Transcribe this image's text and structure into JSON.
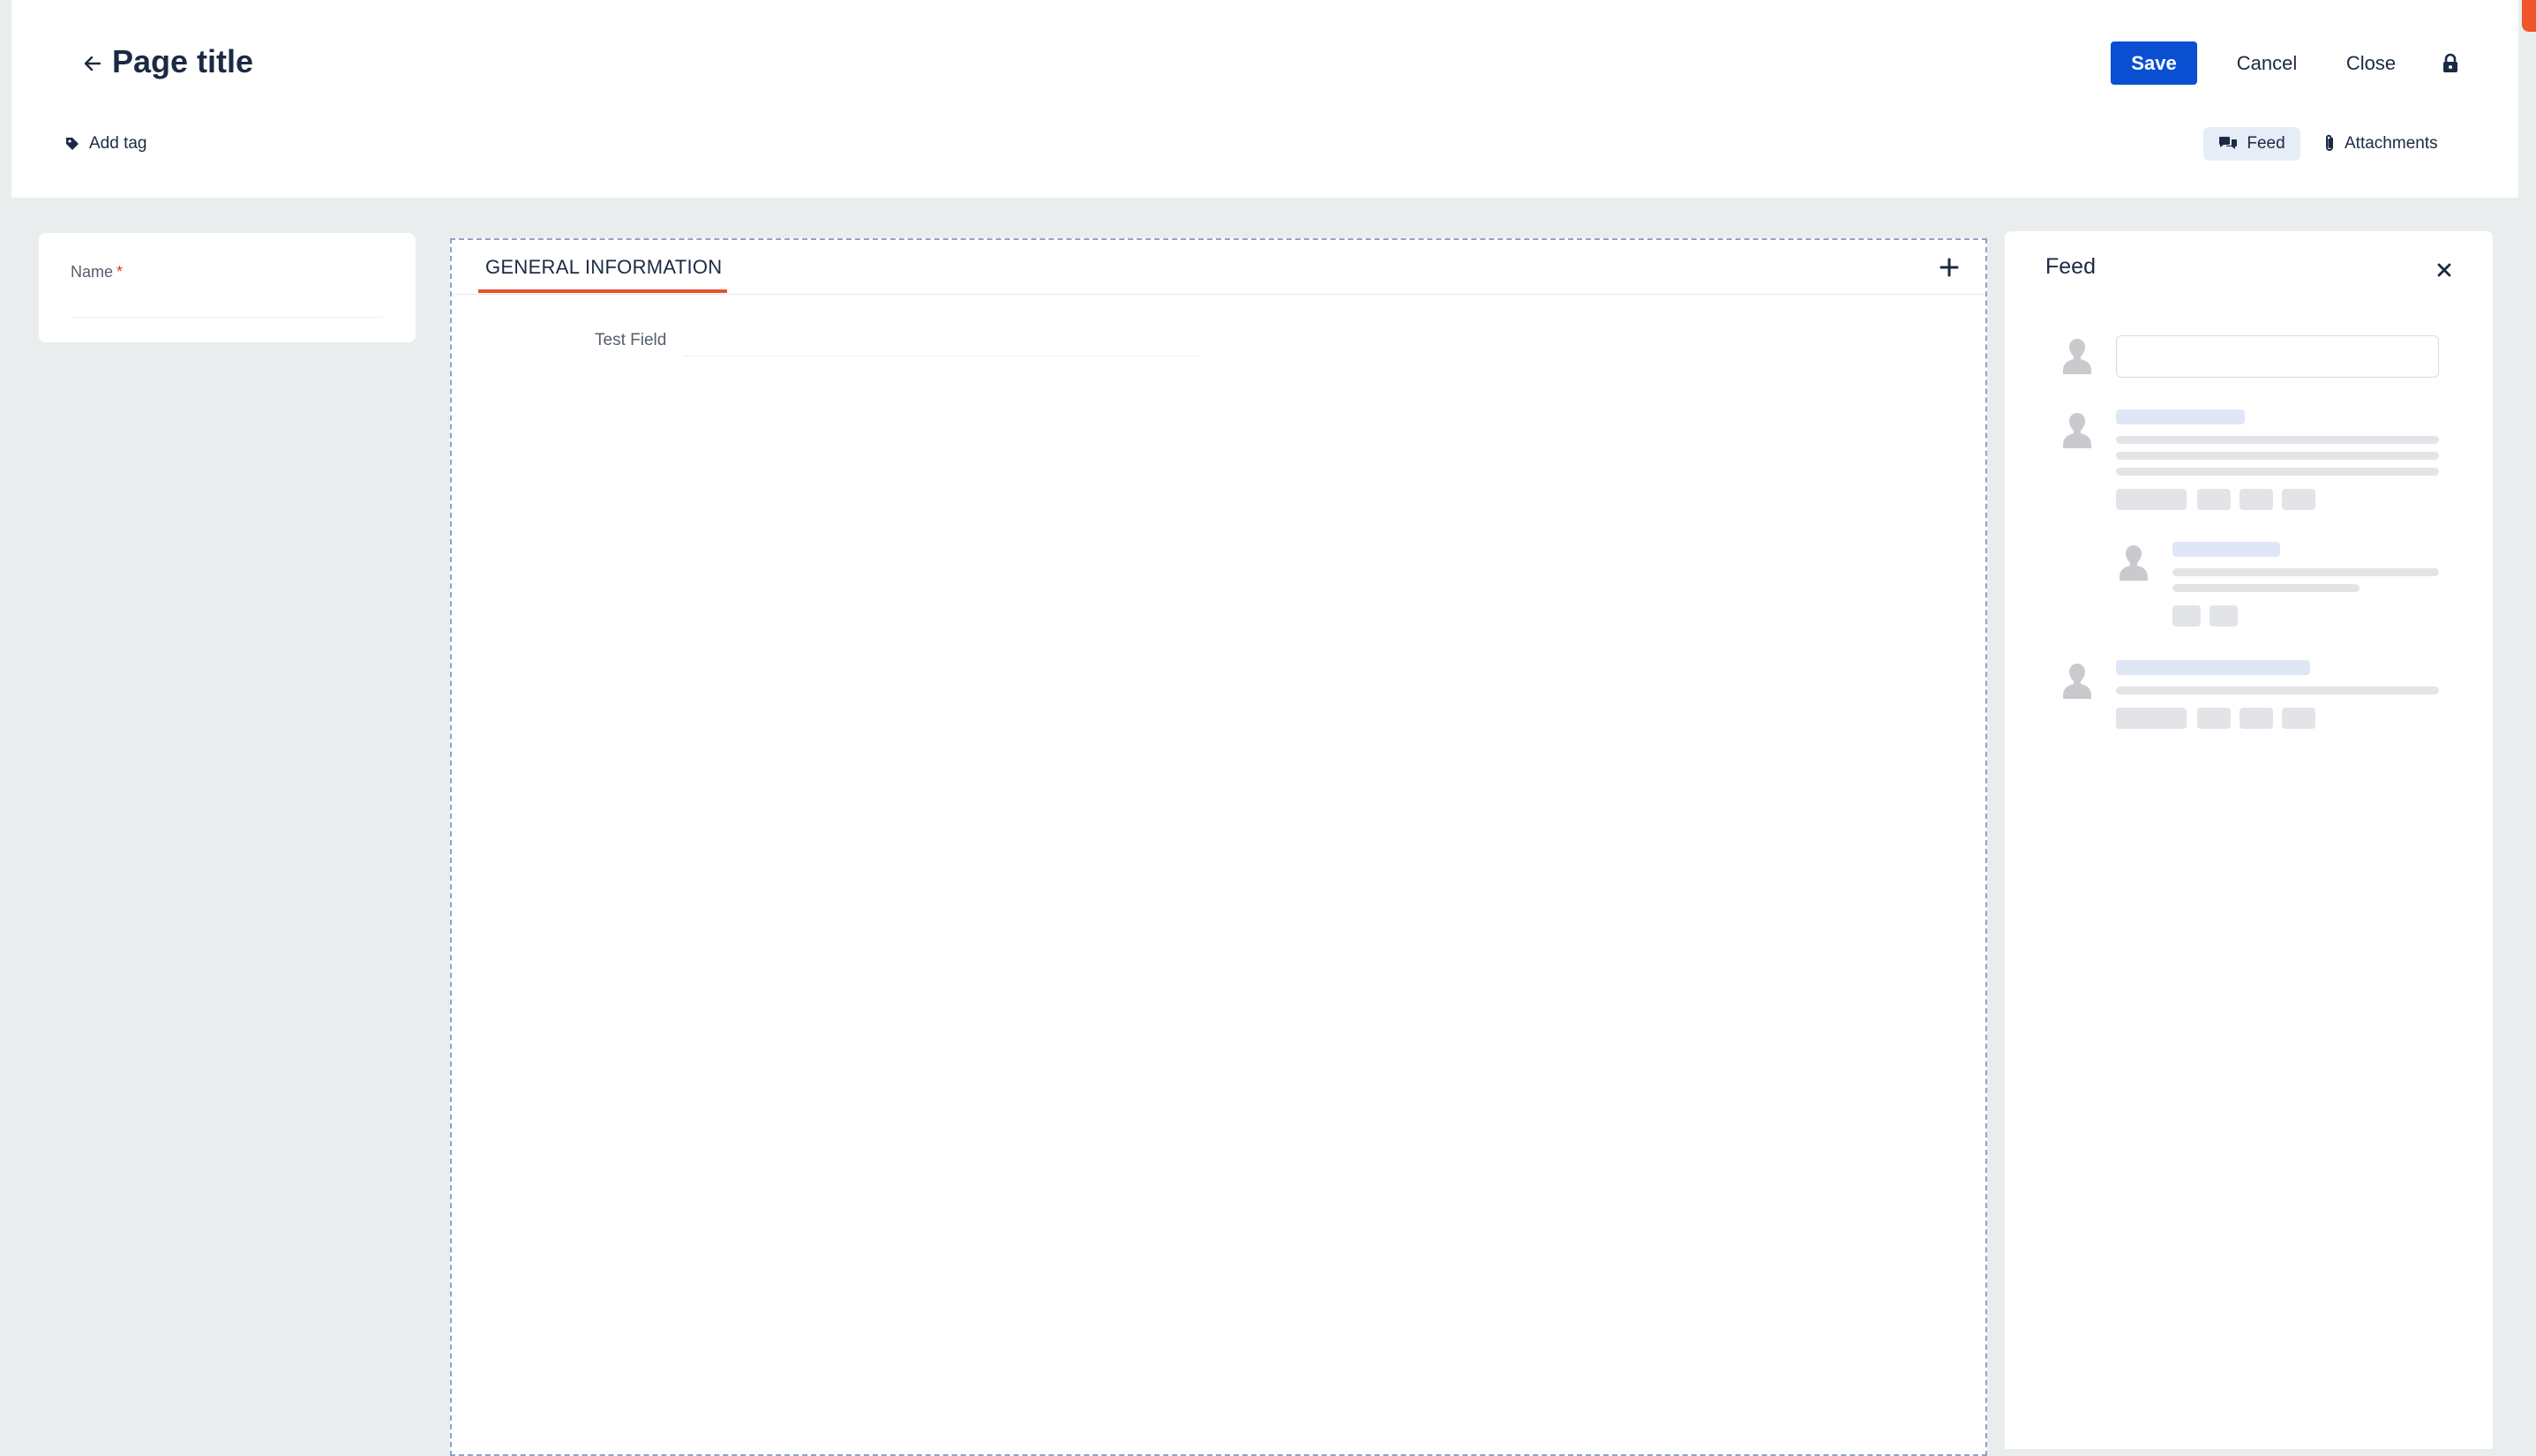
{
  "header": {
    "title": "Page title",
    "actions": {
      "save": "Save",
      "cancel": "Cancel",
      "close": "Close"
    },
    "add_tag": "Add tag",
    "toggles": {
      "feed": "Feed",
      "attachments": "Attachments"
    }
  },
  "form": {
    "name_label": "Name",
    "required_marker": "*"
  },
  "main": {
    "tabs": [
      {
        "label": "GENERAL INFORMATION",
        "active": true
      }
    ],
    "fields": [
      {
        "label": "Test Field",
        "value": ""
      }
    ]
  },
  "feed": {
    "title": "Feed",
    "compose_value": ""
  },
  "colors": {
    "primary": "#0a4fd1",
    "accent": "#e8502c",
    "background": "#e9eded",
    "text": "#1b2a44",
    "skeleton": "#e2e4e7",
    "skeleton_highlight": "#dfe7f6"
  },
  "icons": {
    "back": "arrow-left-icon",
    "lock": "lock-icon",
    "tag": "tag-icon",
    "feed": "chat-bubbles-icon",
    "attachments": "paperclip-icon",
    "add": "plus-icon",
    "close": "close-icon",
    "avatar": "user-placeholder-icon"
  }
}
